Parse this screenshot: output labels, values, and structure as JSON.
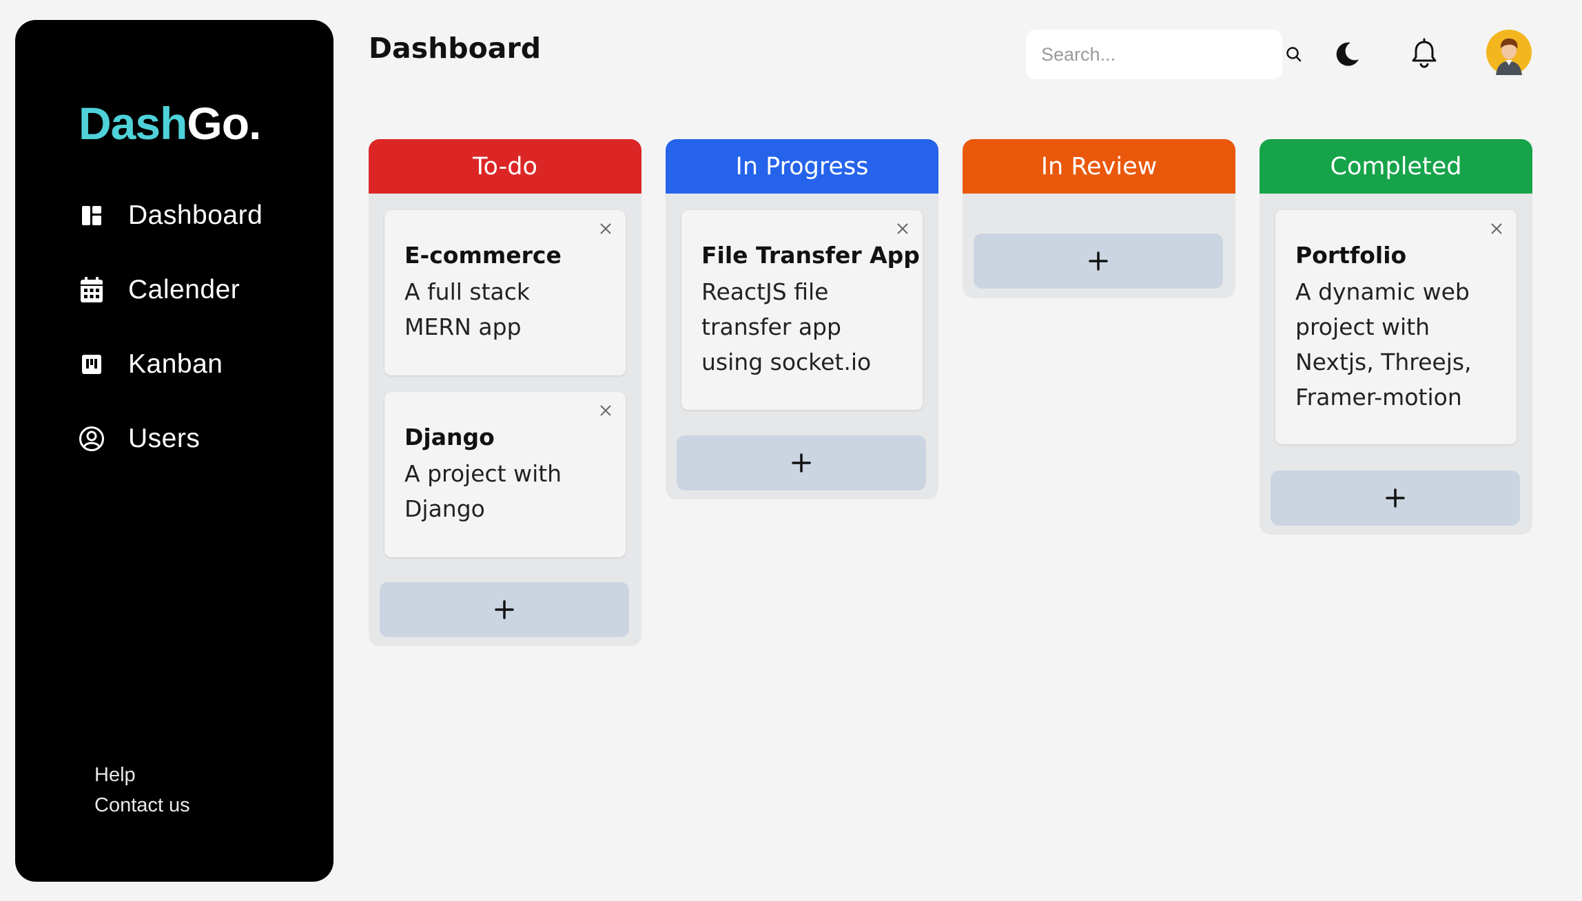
{
  "app": {
    "logo_part1": "Dash",
    "logo_part2": "Go.",
    "brand_color": "#4fd1d9"
  },
  "sidebar": {
    "items": [
      {
        "label": "Dashboard",
        "icon": "dashboard-icon"
      },
      {
        "label": "Calender",
        "icon": "calendar-icon"
      },
      {
        "label": "Kanban",
        "icon": "kanban-icon"
      },
      {
        "label": "Users",
        "icon": "user-circle-icon"
      }
    ],
    "footer": {
      "help": "Help",
      "contact": "Contact us"
    }
  },
  "header": {
    "title": "Dashboard",
    "search_placeholder": "Search..."
  },
  "columns": [
    {
      "title": "To-do",
      "color": "#dc2626",
      "cards": [
        {
          "title": "E-commerce",
          "desc": "A full stack\nMERN app"
        },
        {
          "title": "Django",
          "desc": "A project with\nDjango"
        }
      ]
    },
    {
      "title": "In Progress",
      "color": "#2563eb",
      "cards": [
        {
          "title": "File Transfer App",
          "desc": "ReactJS file\ntransfer app\nusing socket.io"
        }
      ]
    },
    {
      "title": "In Review",
      "color": "#ea580c",
      "cards": []
    },
    {
      "title": "Completed",
      "color": "#16a34a",
      "cards": [
        {
          "title": "Portfolio",
          "desc": "A dynamic web\nproject with\nNextjs, Threejs,\nFramer-motion"
        }
      ]
    }
  ],
  "add_symbol": "+"
}
